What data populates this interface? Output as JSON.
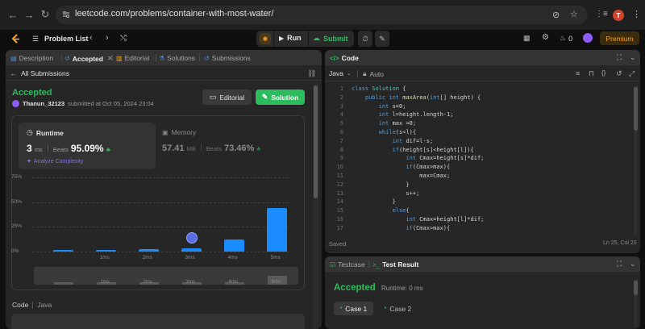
{
  "browser": {
    "url": "leetcode.com/problems/container-with-most-water/",
    "profile_initial": "T"
  },
  "navbar": {
    "problem_list": "Problem List",
    "run": "Run",
    "submit": "Submit",
    "streak_count": "0",
    "premium": "Premium"
  },
  "left_tabs": {
    "description": "Description",
    "accepted": "Accepted",
    "editorial": "Editorial",
    "solutions": "Solutions",
    "submissions": "Submissions"
  },
  "submission": {
    "all_submissions": "All Submissions",
    "status": "Accepted",
    "user": "Thanun_32123",
    "submitted_text": "submitted at Oct 05, 2024 23:04",
    "editorial_button": "Editorial",
    "solution_button": "Solution",
    "runtime_label": "Runtime",
    "runtime_value": "3",
    "runtime_unit": "ms",
    "beats_label": "Beats",
    "runtime_beats": "95.09%",
    "analyze": "Analyze Complexity",
    "memory_label": "Memory",
    "memory_value": "57.41",
    "memory_unit": "MB",
    "memory_beats": "73.46%",
    "code_label": "Code",
    "code_lang": "Java"
  },
  "chart_data": {
    "type": "bar",
    "ytick_labels": [
      "75%",
      "50%",
      "25%",
      "0%"
    ],
    "ylim": [
      0,
      75
    ],
    "xtick_labels": [
      "1ms",
      "2ms",
      "3ms",
      "4ms",
      "5ms"
    ],
    "bars": [
      {
        "x": "0ms",
        "value": 1.5
      },
      {
        "x": "1ms",
        "value": 1.5
      },
      {
        "x": "2ms",
        "value": 2.5
      },
      {
        "x": "3ms",
        "value": 3.5
      },
      {
        "x": "4ms",
        "value": 12
      },
      {
        "x": "5ms",
        "value": 44
      }
    ],
    "highlighted": "3ms",
    "mini_xtick_labels": [
      "1ms",
      "2ms",
      "3ms",
      "4ms",
      "5ms"
    ]
  },
  "code_panel": {
    "title": "Code",
    "language": "Java",
    "autosave": "Auto",
    "saved": "Saved",
    "cursor": "Ln 25, Col 20",
    "lines": [
      "class Solution {",
      "    public int maxArea(int[] height) {",
      "        int s=0;",
      "        int l=height.length-1;",
      "        int max =0;",
      "        while(s<l){",
      "            int dif=l-s;",
      "            if(height[s]<height[l]){",
      "                int Cmax=height[s]*dif;",
      "                if(Cmax>max){",
      "                    max=Cmax;",
      "                }",
      "                s++;",
      "            }",
      "            else{",
      "                int Cmax=height[l]*dif;",
      "                if(Cmax>max){"
    ]
  },
  "bottom_panel": {
    "testcase_tab": "Testcase",
    "result_tab": "Test Result",
    "status": "Accepted",
    "runtime": "Runtime: 0 ms",
    "case1": "Case 1",
    "case2": "Case 2"
  },
  "colors": {
    "accepted": "#2cbb5d",
    "bar": "#1a8cff",
    "premium": "#ffa116"
  }
}
